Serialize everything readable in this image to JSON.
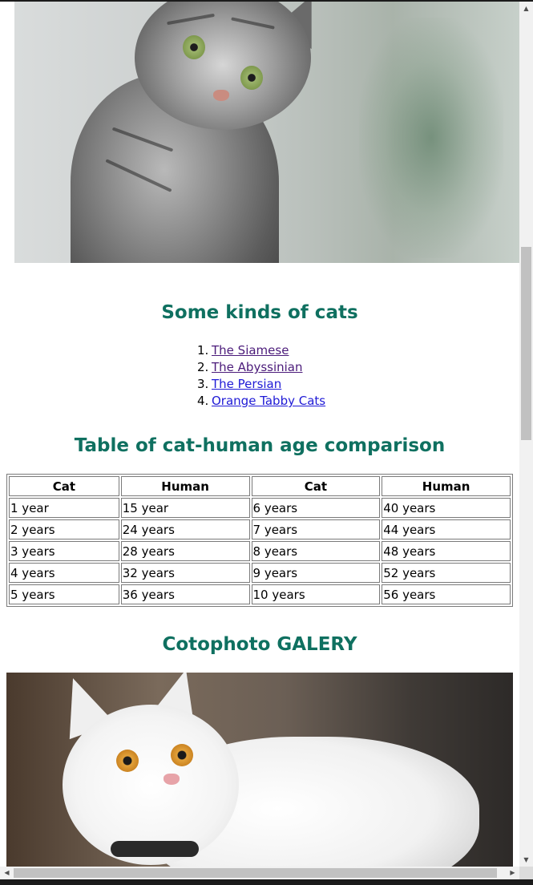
{
  "sections": {
    "kinds_heading": "Some kinds of cats",
    "kinds": [
      {
        "num": "1.",
        "label": "The Siamese"
      },
      {
        "num": "2.",
        "label": "The Abyssinian"
      },
      {
        "num": "3.",
        "label": "The Persian"
      },
      {
        "num": "4.",
        "label": "Orange Tabby Cats"
      }
    ],
    "table_heading": "Table of cat-human age comparison",
    "gallery_heading": "Cotophoto GALERY"
  },
  "age_table": {
    "headers": [
      "Cat",
      "Human",
      "Cat",
      "Human"
    ],
    "rows": [
      [
        "1 year",
        "15 year",
        "6 years",
        "40 years"
      ],
      [
        "2 years",
        "24 years",
        "7 years",
        "44 years"
      ],
      [
        "3 years",
        "28 years",
        "8 years",
        "48 years"
      ],
      [
        "4 years",
        "32 years",
        "9 years",
        "52 years"
      ],
      [
        "5 years",
        "36 years",
        "10 years",
        "56 years"
      ]
    ]
  },
  "colors": {
    "heading": "#0f7060",
    "link_visited": "#4b1b7a",
    "link": "#1f1ad6"
  },
  "icons": {
    "scroll_up": "scroll-up-arrow-icon",
    "scroll_down": "scroll-down-arrow-icon",
    "scroll_left": "scroll-left-arrow-icon",
    "scroll_right": "scroll-right-arrow-icon"
  }
}
